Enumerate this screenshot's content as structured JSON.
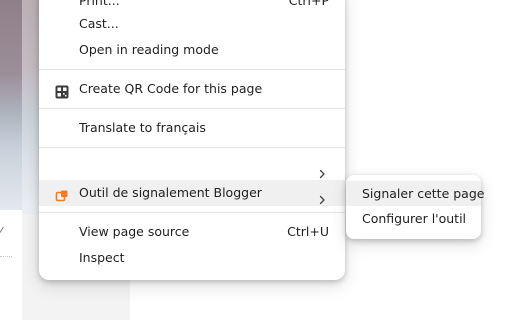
{
  "context_menu": {
    "items": [
      {
        "label": "Print...",
        "shortcut": "Ctrl+P"
      },
      {
        "label": "Cast..."
      },
      {
        "label": "Open in reading mode"
      },
      {
        "label": "Create QR Code for this page",
        "icon": "qr-code-icon"
      },
      {
        "label": "Translate to français"
      },
      {
        "label": "",
        "has_submenu": true
      },
      {
        "label": "Outil de signalement Blogger",
        "icon": "blogger-extension-icon",
        "has_submenu": true,
        "highlighted": true
      },
      {
        "label": "View page source",
        "shortcut": "Ctrl+U"
      },
      {
        "label": "Inspect"
      }
    ]
  },
  "submenu": {
    "items": [
      {
        "label": "Signaler cette page",
        "highlighted": true
      },
      {
        "label": "Configurer l'outil"
      }
    ]
  },
  "colors": {
    "menu_background": "#ffffff",
    "highlight": "#f0f0f0",
    "text": "#1f1f1f",
    "separator": "#e3e3e3",
    "extension_icon_accent": "#f57c20"
  }
}
